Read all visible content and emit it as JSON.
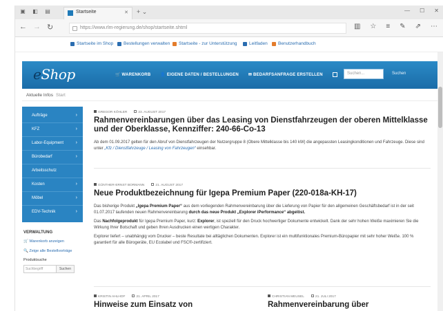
{
  "browser": {
    "tab_title": "Startseite",
    "url": "https://www.rlm-regierung.de/shop/startseite.shtml",
    "favorites": [
      {
        "label": "Startseite im Shop",
        "color": "#2a6db0"
      },
      {
        "label": "Bestellungen verwalten",
        "color": "#2a6db0"
      },
      {
        "label": "Startseite - zur Unterstützung",
        "color": "#e37c2b"
      },
      {
        "label": "Leitfaden",
        "color": "#2a6db0"
      },
      {
        "label": "Benutzerhandbuch",
        "color": "#e37c2b"
      }
    ]
  },
  "shop": {
    "logo_prefix": "e",
    "logo_suffix": "Shop",
    "nav": [
      "WARENKORB",
      "EIGENE DATEN / BESTELLUNGEN",
      "BEDARFSANFRAGE ERSTELLEN"
    ],
    "search_placeholder": "Suchen...",
    "search_button": "Suchen",
    "breadcrumb": "Aktuelle Infos",
    "breadcrumb_extra": "Start"
  },
  "sidebar": {
    "items": [
      "Aufträge",
      "KFZ",
      "Labor-Equipment",
      "Bürobedarf",
      "Arbeitsschutz",
      "Kosten",
      "Möbel",
      "EDV-Technik"
    ],
    "heading": "VERWALTUNG",
    "links": [
      "Warenkorb anzeigen",
      "Zeige alle Bestellvorträge"
    ],
    "search_label": "Produktsuche",
    "search_placeholder": "Suchbegriff",
    "search_button": "Suchen"
  },
  "articles": [
    {
      "author": "GREGOR KÖHLER",
      "date": "23. AUGUST 2017",
      "title": "Rahmenvereinbarungen über das Leasing von Dienstfahrzeugen der oberen Mittelklasse und der Oberklasse, Kennziffer: 240-66-Co-13",
      "body_1": "Ab dem 01.09.2017 gelten für den Abruf von Dienstfahrzeugen der Nutzergruppe 8 (Obere Mittelklasse bis 140 kW) die angepassten Leasingkonditionen und Fahrzeuge. Diese sind unter ",
      "body_link": "„Kfz / Dienstfahrzeuge / Leasing von Fahrzeugen“",
      "body_2": " einsehbar."
    },
    {
      "author": "GÜNTHER-ERNST BORMANN",
      "date": "21. AUGUST 2017",
      "title": "Neue Produktbezeichnung für Igepa Premium Paper (220-018a-KH-17)",
      "p1_a": "Das bisherige Produkt ",
      "p1_b": "„Igepa Premium Paper“",
      "p1_c": " aus dem vorliegenden Rahmenvereinbarung über die Lieferung von Papier für den allgemeinen Geschäftsbedarf ist in der seit 01.07.2017 laufenden neuen Rahmenvereinbarung ",
      "p1_d": "durch das neue Produkt „Explorer iPerformance“ abgelöst.",
      "p2_a": "Das ",
      "p2_b": "Nachfolgeprodukt",
      "p2_c": " für Igepa Premium Paper, kurz: ",
      "p2_d": "Explorer",
      "p2_e": ", ist speziell für den Druck hochwertiger Dokumente entwickelt. Dank der sehr hohen Weiße maximieren Sie die Wirkung Ihrer Botschaft und geben Ihren Ausdrucken einen wertigen Charakter.",
      "p3": "Explorer liefert – unabhängig vom Drucker – beste Resultate bei alltäglichen Dokumenten. Explorer ist ein multifunktionales Premium-Büropapier mit sehr hoher Weiße. 100 % garantiert für alle Bürogeräte, EU Ecolabel und FSC®-zertifiziert."
    },
    {
      "author": "KRISTIN AHLHOF",
      "date": "21. APRIL 2017",
      "title": "Hinweise zum Einsatz von"
    },
    {
      "author": "CHRISTIAN MEUSEL",
      "date": "21. JULI 2017",
      "title": "Rahmenvereinbarung über"
    }
  ]
}
